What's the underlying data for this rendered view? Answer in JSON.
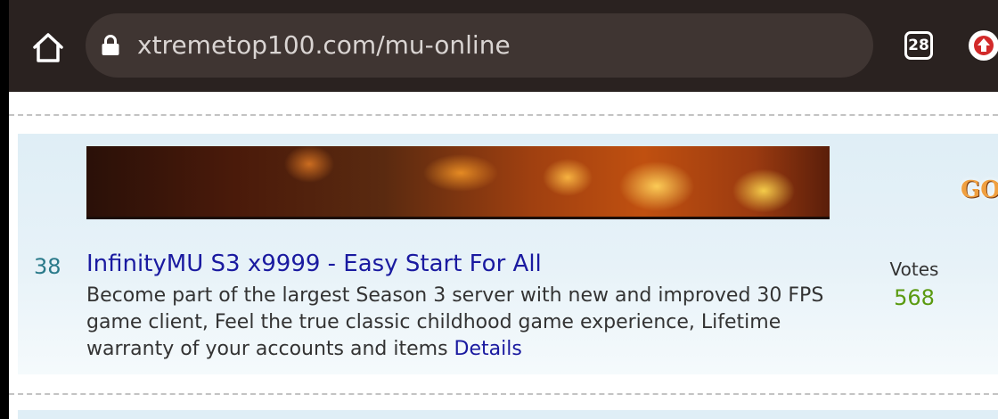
{
  "browser": {
    "url": "xtremetop100.com/mu-online",
    "tab_count": "28"
  },
  "listing": {
    "rank": "38",
    "title": "InfinityMU S3 x9999 - Easy Start For All",
    "description": "Become part of the largest Season 3 server with new and improved 30 FPS game client, Feel the true classic childhood game experience, Lifetime warranty of your accounts and items",
    "details_label": "Details",
    "votes_label": "Votes",
    "votes_count": "568"
  },
  "ad": {
    "text_fragment": "GO"
  },
  "colors": {
    "toolbar": "#2a2220",
    "url_bar": "#3f3532",
    "link": "#1a1aa0",
    "rank": "#2a7a8a",
    "votes": "#5a9a10",
    "update_arrow": "#d22a2a"
  }
}
